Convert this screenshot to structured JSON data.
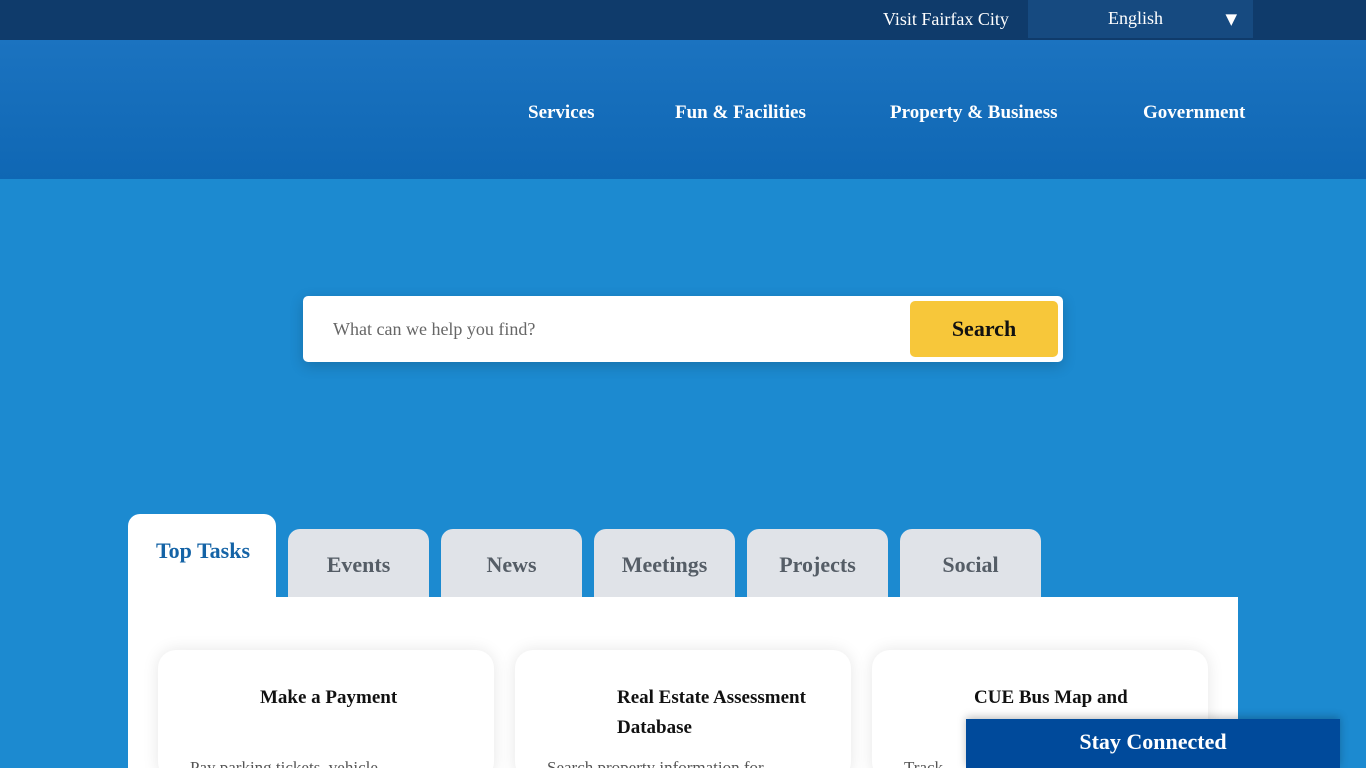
{
  "utility": {
    "visit_link": "Visit Fairfax City",
    "language": {
      "selected": "English",
      "chevron_icon": "chevron-down-icon"
    }
  },
  "nav": {
    "items": [
      {
        "label": "Services"
      },
      {
        "label": "Fun & Facilities"
      },
      {
        "label": "Property & Business"
      },
      {
        "label": "Government"
      }
    ]
  },
  "search": {
    "placeholder": "What can we help you find?",
    "button_label": "Search"
  },
  "tabs": [
    {
      "label": "Top Tasks",
      "active": true
    },
    {
      "label": "Events"
    },
    {
      "label": "News"
    },
    {
      "label": "Meetings"
    },
    {
      "label": "Projects"
    },
    {
      "label": "Social"
    }
  ],
  "cards": [
    {
      "title": "Make a Payment",
      "desc": "Pay parking tickets, vehicle..."
    },
    {
      "title": "Real Estate Assessment Database",
      "desc": "Search property information for..."
    },
    {
      "title": "CUE Bus Map and",
      "desc": "Track..."
    }
  ],
  "stay_connected": {
    "label": "Stay Connected"
  },
  "colors": {
    "utility_bar": "#0f3b6b",
    "header": "#1b73c0",
    "hero": "#1c8ad0",
    "search_button": "#f7c73a",
    "active_tab_text": "#1463a6",
    "stay_connected": "#004a9b"
  }
}
